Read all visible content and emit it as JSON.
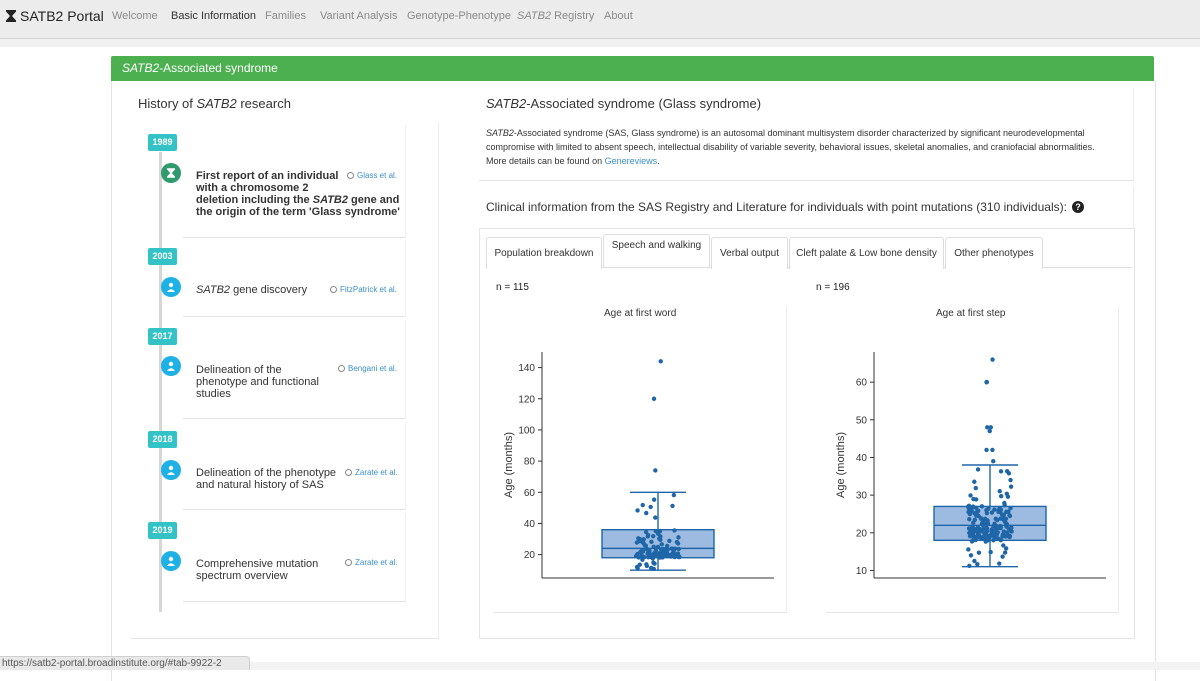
{
  "nav": {
    "brand": "SATB2 Portal",
    "items": [
      "Welcome",
      "Basic Information",
      "Families",
      "Variant Analysis",
      "Genotype-Phenotype",
      "SATB2 Registry",
      "About"
    ],
    "active": "Basic Information"
  },
  "panel": {
    "title_italic": "SATB2",
    "title_rest": "-Associated syndrome",
    "accent": "#4caf50"
  },
  "history": {
    "title_pre": "History of ",
    "title_italic": "SATB2",
    "title_post": " research",
    "events": [
      {
        "year": "1989",
        "icon": "hourglass-icon",
        "line1": "First report of an individual",
        "line2": "with a chromosome 2",
        "line3_pre": "deletion including the ",
        "line3_italic": "SATB2",
        "line3_post": " gene and",
        "line4": "the origin of the term 'Glass syndrome'",
        "cite": "Glass et al."
      },
      {
        "year": "2003",
        "icon": "user-icon",
        "text_italic": "SATB2",
        "text_rest": " gene discovery",
        "cite": "FitzPatrick et al."
      },
      {
        "year": "2017",
        "icon": "user-icon",
        "line1": "Delineation of the",
        "line2": "phenotype and functional",
        "line3": "studies",
        "cite": "Bengani et al."
      },
      {
        "year": "2018",
        "icon": "user-icon",
        "line1": "Delineation of the phenotype",
        "line2": "and natural history of SAS",
        "cite": "Zarate et al."
      },
      {
        "year": "2019",
        "icon": "user-icon",
        "line1": "Comprehensive mutation",
        "line2": "spectrum overview",
        "cite": "Zarate et al."
      }
    ]
  },
  "sas": {
    "title_italic": "SATB2",
    "title_rest": "-Associated syndrome (Glass syndrome)",
    "desc_italic": "SATB2",
    "desc_line1": "-Associated syndrome (SAS, Glass syndrome) is an autosomal dominant multisystem disorder characterized by significant neurodevelopmental",
    "desc_line2": "compromise with limited to absent speech, intellectual disability of variable severity, behavioral issues, skeletal anomalies, and craniofacial abnormalities.",
    "desc_line3_pre": "More details can be found on ",
    "link": "Genereviews",
    "desc_line3_post": "."
  },
  "clinical": {
    "title": "Clinical information from the SAS Registry and Literature for individuals with point mutations (310 individuals):",
    "help": "?"
  },
  "tabs": [
    "Population breakdown",
    "Speech and walking",
    "Verbal output",
    "Cleft palate & Low bone density",
    "Other phenotypes"
  ],
  "active_tab": "Speech and walking",
  "chart_data": [
    {
      "type": "box",
      "n_label": "n = 115",
      "title": "Age at first word",
      "ylabel": "Age (months)",
      "yticks": [
        20,
        40,
        60,
        80,
        100,
        120,
        140
      ],
      "ylim": [
        5,
        150
      ],
      "box": {
        "min": 10,
        "q1": 18,
        "median": 24,
        "q3": 36,
        "max": 60
      },
      "n": 115,
      "outliers": [
        74,
        120,
        144
      ],
      "color": "#1f66a8"
    },
    {
      "type": "box",
      "n_label": "n = 196",
      "title": "Age at first step",
      "ylabel": "Age (months)",
      "yticks": [
        10,
        20,
        30,
        40,
        50,
        60
      ],
      "ylim": [
        8,
        68
      ],
      "box": {
        "min": 11,
        "q1": 18,
        "median": 22,
        "q3": 27,
        "max": 38
      },
      "n": 196,
      "outliers": [
        39,
        42,
        42,
        47,
        48,
        48,
        60,
        60,
        66
      ],
      "color": "#1f66a8"
    }
  ],
  "status_url": "https://satb2-portal.broadinstitute.org/#tab-9922-2"
}
